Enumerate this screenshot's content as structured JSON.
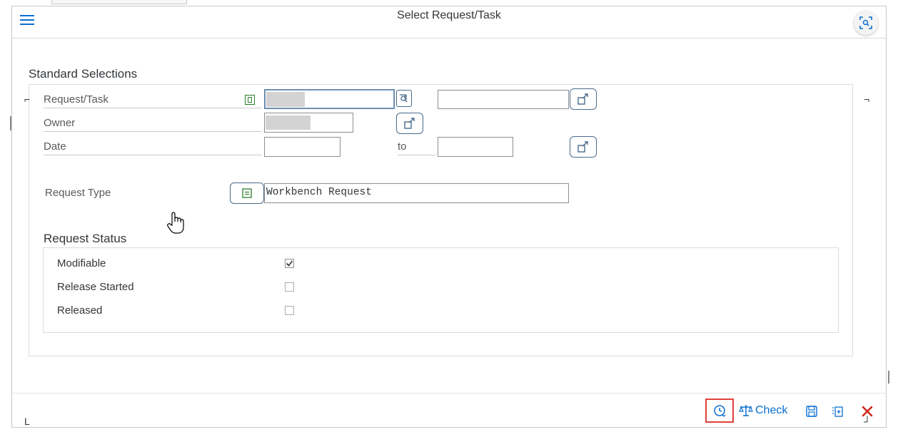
{
  "header": {
    "title": "Select Request/Task",
    "menu_icon": "hamburger-icon",
    "screenshot_icon": "screenshot-focus-icon"
  },
  "standard_selections": {
    "title": "Standard Selections",
    "request_task": {
      "label": "Request/Task",
      "value_from": "",
      "value_to": ""
    },
    "owner": {
      "label": "Owner",
      "value": ""
    },
    "date": {
      "label": "Date",
      "value_from": "",
      "to_label": "to",
      "value_to": ""
    },
    "request_type": {
      "label": "Request Type",
      "value": "Workbench Request"
    }
  },
  "request_status": {
    "title": "Request Status",
    "options": [
      {
        "label": "Modifiable",
        "checked": true
      },
      {
        "label": "Release Started",
        "checked": false
      },
      {
        "label": "Released",
        "checked": false
      }
    ]
  },
  "footer": {
    "check_label": "Check",
    "icons": [
      "history-icon",
      "check-scale-icon",
      "save-icon",
      "add-entry-icon",
      "close-icon"
    ]
  },
  "colors": {
    "accent": "#0a6ed1",
    "close": "#d0271d",
    "highlight": "#e0403a",
    "blurred_value": "#d3d3d3"
  }
}
